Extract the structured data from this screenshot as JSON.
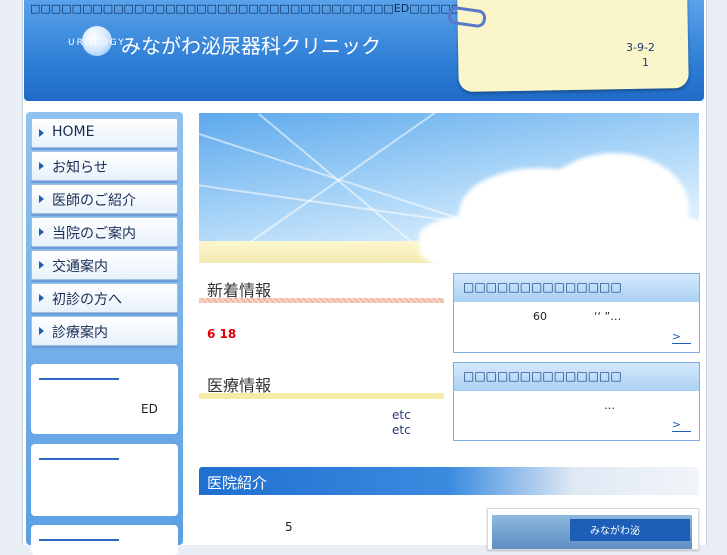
{
  "header": {
    "tagline": "□□□□□□□□□□□□□□□□□□□□□□□□□□□□□□□□□□□ED□□□□□□□□□□□□□□□□□□□□",
    "logo_text": "UROLOGY",
    "clinic_name": "みながわ泌尿器科クリニック",
    "address_line1": "3-9-2",
    "address_line2": "1"
  },
  "sidebar": {
    "items": [
      {
        "label": "HOME"
      },
      {
        "label": "お知らせ"
      },
      {
        "label": "医師のご紹介"
      },
      {
        "label": "当院のご案内"
      },
      {
        "label": "交通案内"
      },
      {
        "label": "初診の方へ"
      },
      {
        "label": "診療案内"
      }
    ],
    "box1_text": "ED"
  },
  "main": {
    "news": {
      "title": "新着情報",
      "date": "6  18"
    },
    "medical": {
      "title": "医療情報",
      "etc1": "etc",
      "etc2": "etc"
    },
    "box1": {
      "header": "□□□□□□□□□□□□□□",
      "text_num": "60",
      "text_quote": "‘‘    ”…",
      "more": ">"
    },
    "box2": {
      "header": "□□□□□□□□□□□□□□",
      "text": "…",
      "more": ">"
    },
    "intro": {
      "title": "医院紹介",
      "number": "5",
      "sign_text": "みながわ泌"
    }
  },
  "colors": {
    "header_blue": "#2f7fd6",
    "nav_text": "#1a2d55",
    "news_date_red": "#e40000",
    "link_blue": "#1f5cc0"
  }
}
